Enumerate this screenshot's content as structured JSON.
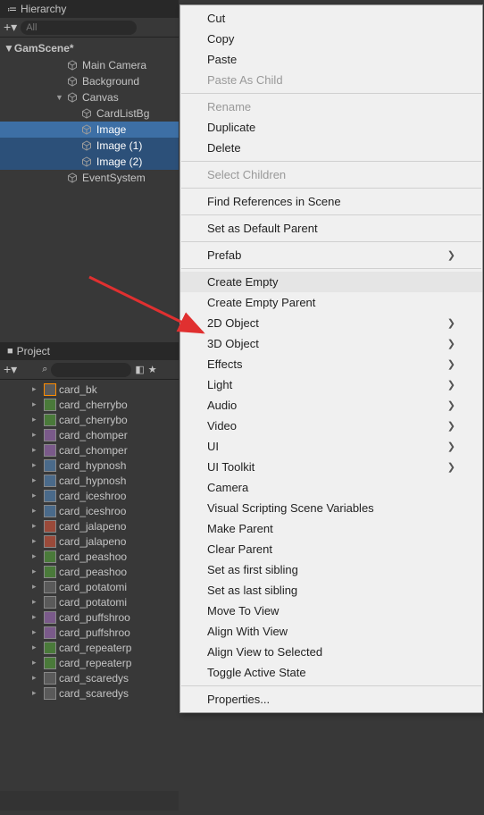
{
  "hierarchy": {
    "tab_title": "Hierarchy",
    "search_placeholder": "All",
    "scene_name": "GamScene*",
    "items": [
      {
        "label": "Main Camera",
        "depth": 2
      },
      {
        "label": "Background",
        "depth": 2
      },
      {
        "label": "Canvas",
        "depth": 2,
        "expanded": true
      },
      {
        "label": "CardListBg",
        "depth": 3
      },
      {
        "label": "Image",
        "depth": 3,
        "selected": true
      },
      {
        "label": "Image (1)",
        "depth": 3,
        "multi": true
      },
      {
        "label": "Image (2)",
        "depth": 3,
        "multi": true
      },
      {
        "label": "EventSystem",
        "depth": 2
      }
    ]
  },
  "project": {
    "tab_title": "Project",
    "assets": [
      {
        "label": "card_bk",
        "selected": true
      },
      {
        "label": "card_cherrybo"
      },
      {
        "label": "card_cherrybo"
      },
      {
        "label": "card_chomper"
      },
      {
        "label": "card_chomper"
      },
      {
        "label": "card_hypnosh"
      },
      {
        "label": "card_hypnosh"
      },
      {
        "label": "card_iceshroo"
      },
      {
        "label": "card_iceshroo"
      },
      {
        "label": "card_jalapeno"
      },
      {
        "label": "card_jalapeno"
      },
      {
        "label": "card_peashoo"
      },
      {
        "label": "card_peashoo"
      },
      {
        "label": "card_potatomi"
      },
      {
        "label": "card_potatomi"
      },
      {
        "label": "card_puffshroo"
      },
      {
        "label": "card_puffshroo"
      },
      {
        "label": "card_repeaterp"
      },
      {
        "label": "card_repeaterp"
      },
      {
        "label": "card_scaredys"
      },
      {
        "label": "card_scaredys"
      }
    ]
  },
  "context_menu": {
    "groups": [
      [
        {
          "label": "Cut"
        },
        {
          "label": "Copy"
        },
        {
          "label": "Paste"
        },
        {
          "label": "Paste As Child",
          "disabled": true
        }
      ],
      [
        {
          "label": "Rename",
          "disabled": true
        },
        {
          "label": "Duplicate"
        },
        {
          "label": "Delete"
        }
      ],
      [
        {
          "label": "Select Children",
          "disabled": true
        }
      ],
      [
        {
          "label": "Find References in Scene"
        }
      ],
      [
        {
          "label": "Set as Default Parent"
        }
      ],
      [
        {
          "label": "Prefab",
          "submenu": true
        }
      ],
      [
        {
          "label": "Create Empty",
          "highlighted": true
        },
        {
          "label": "Create Empty Parent"
        },
        {
          "label": "2D Object",
          "submenu": true
        },
        {
          "label": "3D Object",
          "submenu": true
        },
        {
          "label": "Effects",
          "submenu": true
        },
        {
          "label": "Light",
          "submenu": true
        },
        {
          "label": "Audio",
          "submenu": true
        },
        {
          "label": "Video",
          "submenu": true
        },
        {
          "label": "UI",
          "submenu": true
        },
        {
          "label": "UI Toolkit",
          "submenu": true
        },
        {
          "label": "Camera"
        },
        {
          "label": "Visual Scripting Scene Variables"
        },
        {
          "label": "Make Parent"
        },
        {
          "label": "Clear Parent"
        },
        {
          "label": "Set as first sibling"
        },
        {
          "label": "Set as last sibling"
        },
        {
          "label": "Move To View"
        },
        {
          "label": "Align With View"
        },
        {
          "label": "Align View to Selected"
        },
        {
          "label": "Toggle Active State"
        }
      ],
      [
        {
          "label": "Properties..."
        }
      ]
    ]
  }
}
